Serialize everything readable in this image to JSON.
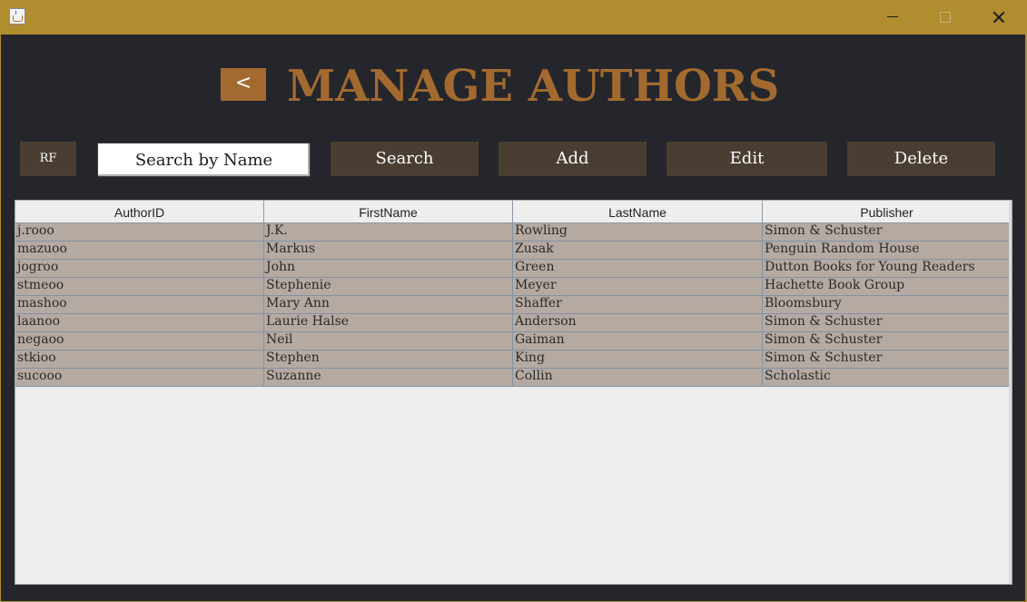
{
  "window": {
    "app_icon": "java-cup-icon",
    "controls": {
      "minimize": "minimize-icon",
      "maximize": "maximize-icon",
      "close": "close-icon"
    }
  },
  "header": {
    "back_label": "<",
    "title": "MANAGE AUTHORS"
  },
  "toolbar": {
    "rf_label": "RF",
    "search_value": "Search by Name",
    "search_label": "Search",
    "add_label": "Add",
    "edit_label": "Edit",
    "delete_label": "Delete"
  },
  "table": {
    "columns": [
      "AuthorID",
      "FirstName",
      "LastName",
      "Publisher"
    ],
    "rows": [
      [
        "j.rooo",
        "J.K.",
        "Rowling",
        "Simon & Schuster"
      ],
      [
        "mazuoo",
        "Markus",
        "Zusak",
        "Penguin Random House"
      ],
      [
        "jogroo",
        "John",
        "Green",
        "Dutton Books for Young Readers"
      ],
      [
        "stmeoo",
        "Stephenie",
        "Meyer",
        "Hachette Book Group"
      ],
      [
        "mashoo",
        "Mary Ann",
        "Shaffer",
        "Bloomsbury"
      ],
      [
        "laanoo",
        "Laurie Halse",
        "Anderson",
        "Simon & Schuster"
      ],
      [
        "negaoo",
        "Neil",
        "Gaiman",
        "Simon & Schuster"
      ],
      [
        "stkioo",
        "Stephen",
        "King",
        "Simon & Schuster"
      ],
      [
        "sucooo",
        "Suzanne",
        "Collin",
        "Scholastic"
      ]
    ]
  },
  "colors": {
    "titlebar": "#b08d2e",
    "background": "#24262b",
    "accent": "#a36a30",
    "button": "#4a3e32",
    "row_selected": "#b5aaa2"
  }
}
